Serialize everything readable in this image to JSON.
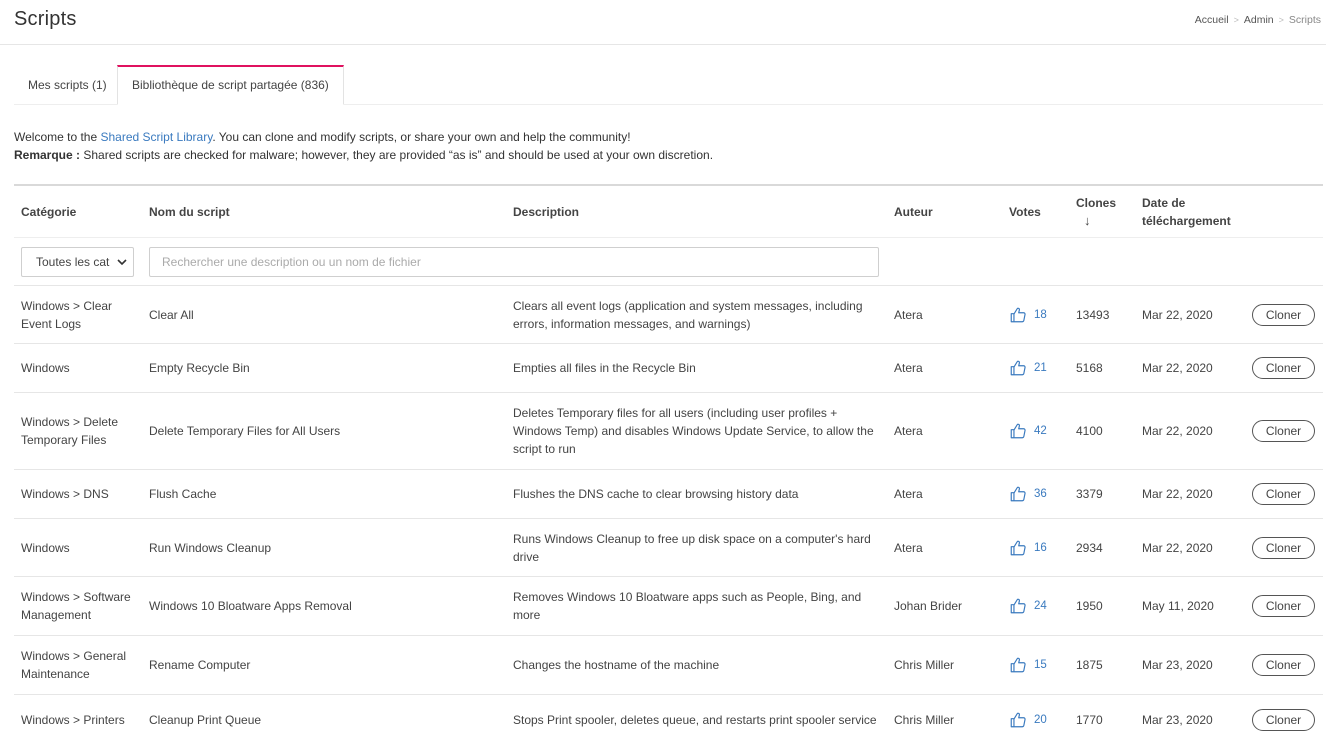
{
  "header": {
    "title": "Scripts",
    "breadcrumb": [
      "Accueil",
      "Admin",
      "Scripts"
    ]
  },
  "tabs": [
    {
      "label": "Mes scripts (1)",
      "active": false
    },
    {
      "label": "Bibliothèque de script partagée (836)",
      "active": true
    }
  ],
  "intro": {
    "line1_pre": "Welcome to the ",
    "line1_link": "Shared Script Library",
    "line1_post": ". You can clone and modify scripts, or share your own and help the community!",
    "note_label": "Remarque :",
    "note_text": " Shared scripts are checked for malware; however, they are provided “as is” and should be used at your own discretion."
  },
  "table": {
    "headers": {
      "category": "Catégorie",
      "name": "Nom du script",
      "description": "Description",
      "author": "Auteur",
      "votes": "Votes",
      "clones": "Clones",
      "clones_sort": "↓",
      "date_line1": "Date de",
      "date_line2": "téléchargement"
    },
    "filter": {
      "category_value": "Toutes les cat",
      "search_placeholder": "Rechercher une description ou un nom de fichier"
    },
    "clone_label": "Cloner",
    "rows": [
      {
        "category": "Windows > Clear Event Logs",
        "name": "Clear All",
        "description": "Clears all event logs (application and system messages, including errors, information messages, and warnings)",
        "author": "Atera",
        "votes": "18",
        "clones": "13493",
        "date": "Mar 22, 2020"
      },
      {
        "category": "Windows",
        "name": "Empty Recycle Bin",
        "description": "Empties all files in the Recycle Bin",
        "author": "Atera",
        "votes": "21",
        "clones": "5168",
        "date": "Mar 22, 2020"
      },
      {
        "category": "Windows > Delete Temporary Files",
        "name": "Delete Temporary Files for All Users",
        "description": "Deletes Temporary files for all users (including user profiles + Windows Temp) and disables Windows Update Service, to allow the script to run",
        "author": "Atera",
        "votes": "42",
        "clones": "4100",
        "date": "Mar 22, 2020"
      },
      {
        "category": "Windows > DNS",
        "name": "Flush Cache",
        "description": "Flushes the DNS cache to clear browsing history data",
        "author": "Atera",
        "votes": "36",
        "clones": "3379",
        "date": "Mar 22, 2020"
      },
      {
        "category": "Windows",
        "name": "Run Windows Cleanup",
        "description": "Runs Windows Cleanup to free up disk space on a computer's hard drive",
        "author": "Atera",
        "votes": "16",
        "clones": "2934",
        "date": "Mar 22, 2020"
      },
      {
        "category": "Windows > Software Management",
        "name": "Windows 10 Bloatware Apps Removal",
        "description": "Removes Windows 10 Bloatware apps such as People, Bing, and more",
        "author": "Johan Brider",
        "votes": "24",
        "clones": "1950",
        "date": "May 11, 2020"
      },
      {
        "category": "Windows > General Maintenance",
        "name": "Rename Computer",
        "description": "Changes the hostname of the machine",
        "author": "Chris Miller",
        "votes": "15",
        "clones": "1875",
        "date": "Mar 23, 2020"
      },
      {
        "category": "Windows > Printers",
        "name": "Cleanup Print Queue",
        "description": "Stops Print spooler, deletes queue, and restarts print spooler service",
        "author": "Chris Miller",
        "votes": "20",
        "clones": "1770",
        "date": "Mar 23, 2020"
      }
    ]
  }
}
